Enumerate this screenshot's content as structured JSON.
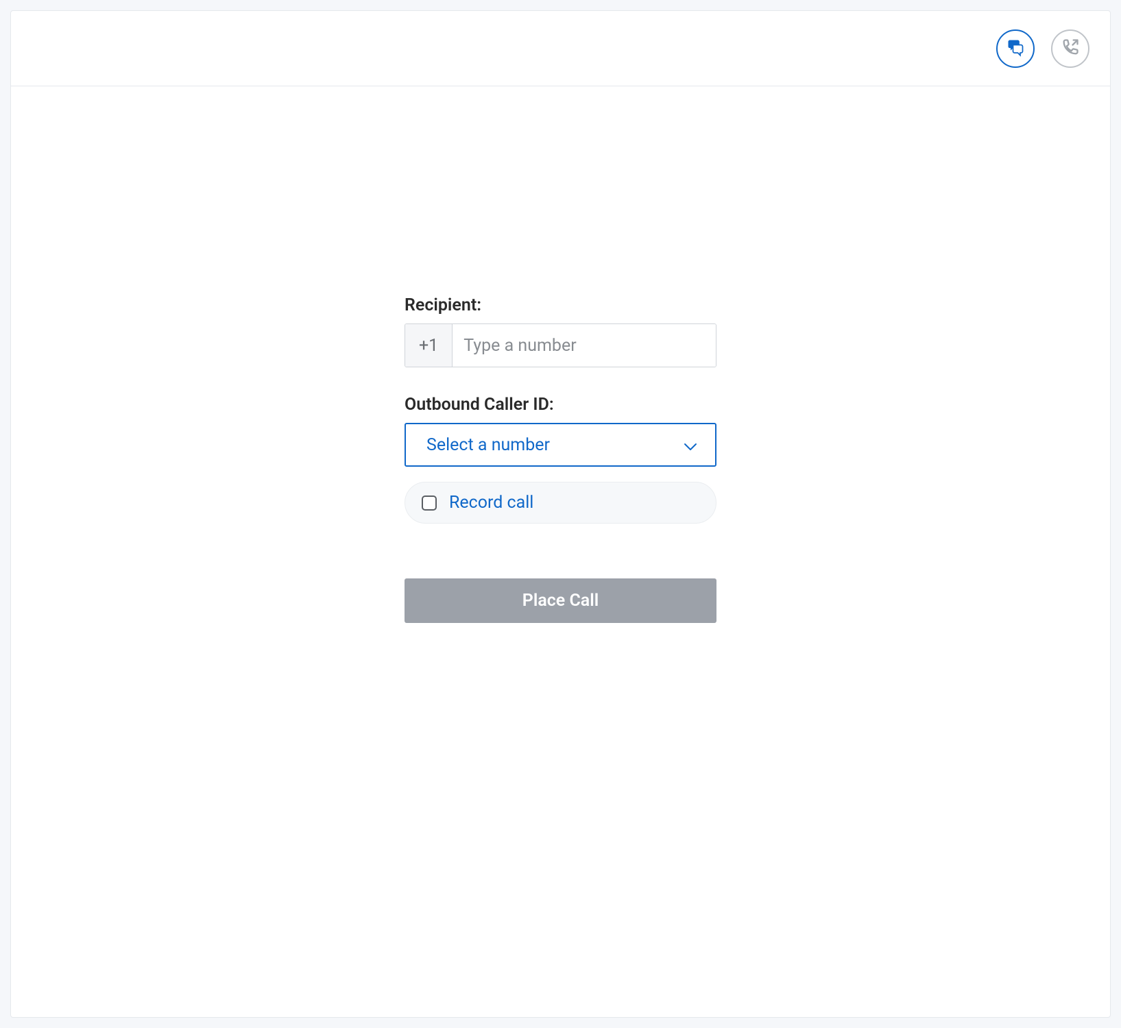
{
  "header": {
    "chat_icon": "chat",
    "phone_icon": "phone-outgoing"
  },
  "form": {
    "recipient_label": "Recipient:",
    "country_prefix": "+1",
    "recipient_placeholder": "Type a number",
    "caller_id_label": "Outbound Caller ID:",
    "caller_id_placeholder": "Select a number",
    "record_label": "Record call",
    "record_checked": false,
    "place_call_label": "Place Call"
  }
}
